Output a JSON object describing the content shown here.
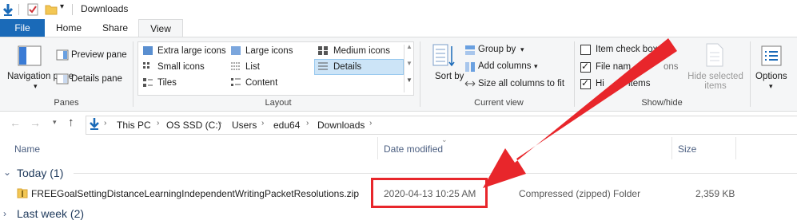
{
  "window": {
    "title": "Downloads"
  },
  "tabs": [
    {
      "label": "File"
    },
    {
      "label": "Home"
    },
    {
      "label": "Share"
    },
    {
      "label": "View"
    }
  ],
  "ribbon": {
    "panes": {
      "navigation_pane": "Navigation pane",
      "preview_pane": "Preview pane",
      "details_pane": "Details pane",
      "group_label": "Panes"
    },
    "layout": {
      "items": [
        "Extra large icons",
        "Large icons",
        "Medium icons",
        "Small icons",
        "List",
        "Details",
        "Tiles",
        "Content"
      ],
      "selected": "Details",
      "group_label": "Layout"
    },
    "current_view": {
      "sort_by": "Sort by",
      "group_by": "Group by",
      "add_columns": "Add columns",
      "size_all_columns": "Size all columns to fit",
      "group_label": "Current view"
    },
    "show_hide": {
      "item_check_boxes": "Item check box",
      "file_name_extensions": "File nam",
      "file_name_extensions_tail": "ons",
      "hidden_items": "Hi",
      "hidden_items_tail": "items",
      "hide_selected_items": "Hide selected items",
      "hide_selected_line1": "Hide selected",
      "hide_selected_line2": "items",
      "group_label": "Show/hide",
      "checks": {
        "item_check_boxes": false,
        "file_name_extensions": true,
        "hidden_items": true
      }
    },
    "options": "Options"
  },
  "address": {
    "breadcrumb": [
      "This PC",
      "OS SSD (C:)",
      "Users",
      "edu64",
      "Downloads"
    ]
  },
  "columns": [
    "Name",
    "Date modified",
    "Size"
  ],
  "groups": [
    {
      "title": "Today (1)",
      "files": [
        {
          "name": "FREEGoalSettingDistanceLearningIndependentWritingPacketResolutions.zip",
          "date_modified": "2020-04-13 10:25 AM",
          "type": "Compressed (zipped) Folder",
          "size": "2,359 KB"
        }
      ]
    },
    {
      "title": "Last week (2)"
    }
  ],
  "colors": {
    "file_tab": "#1a6ab8",
    "highlight_red": "#e8262b",
    "group_title": "#1e395b"
  }
}
